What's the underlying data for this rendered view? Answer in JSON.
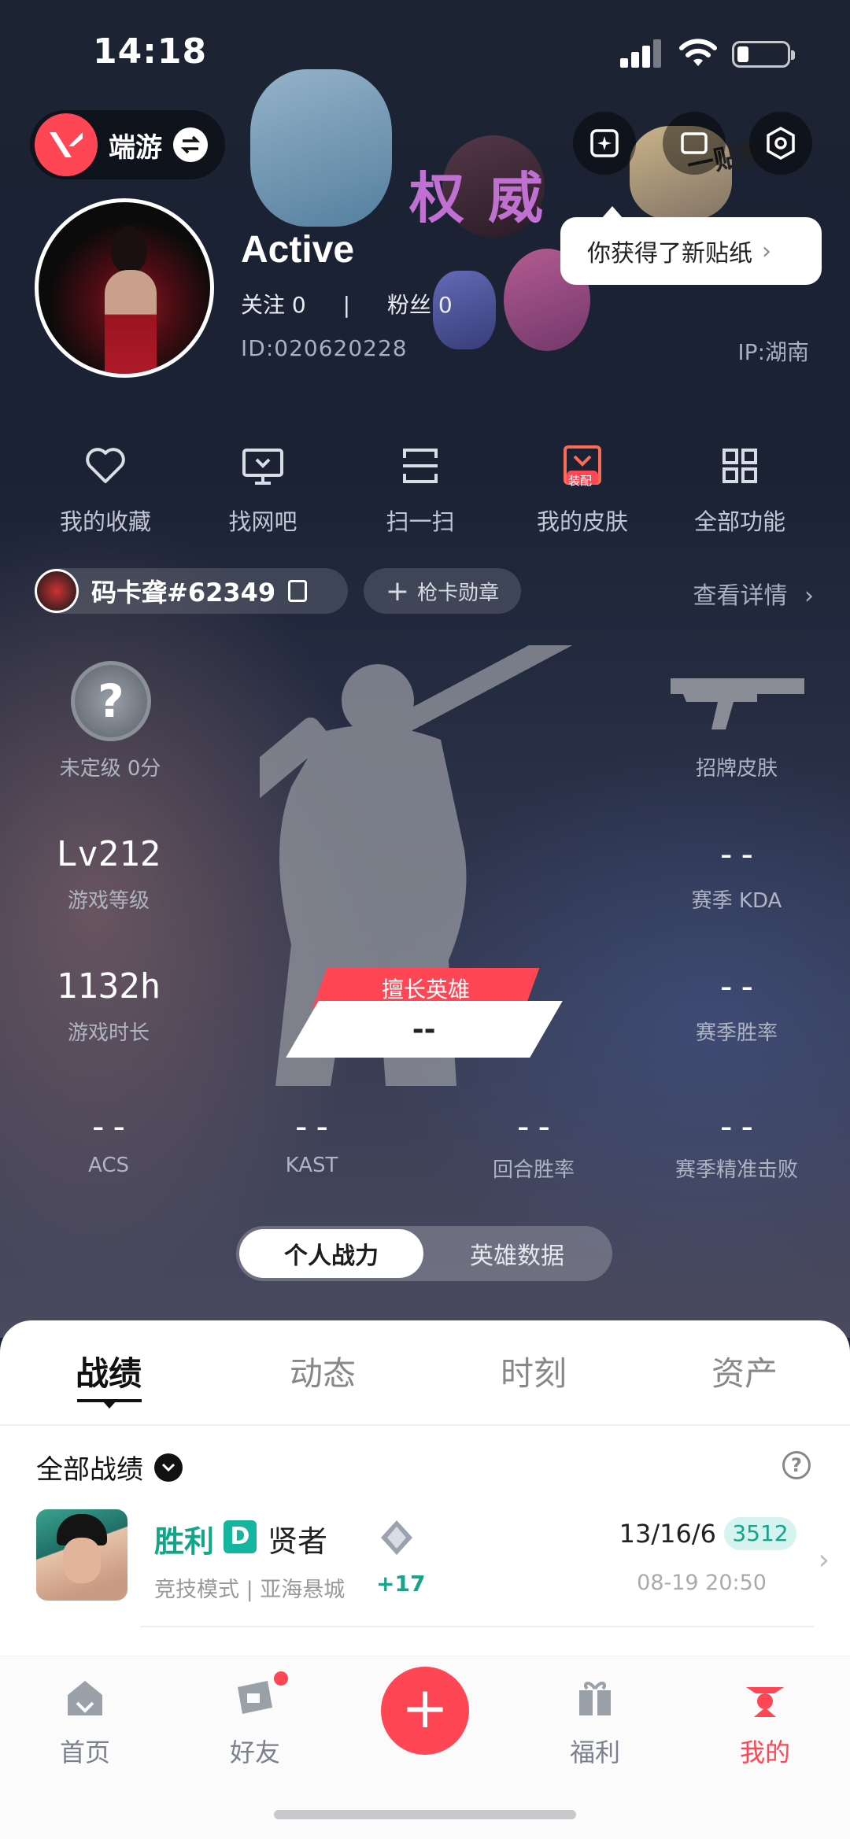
{
  "status_bar": {
    "time": "14:18"
  },
  "header": {
    "mode_label": "端游",
    "tooltip": "你获得了新贴纸",
    "sticker_text": "权威",
    "sticker_text2": "一贴秒!"
  },
  "profile": {
    "name": "Active",
    "follow": "关注 0",
    "fans": "粉丝 0",
    "separator": "|",
    "id": "ID:020620228",
    "ip": "IP:湖南"
  },
  "quick_menu": {
    "items": [
      {
        "label": "我的收藏",
        "icon": "heart-icon"
      },
      {
        "label": "找网吧",
        "icon": "monitor-icon"
      },
      {
        "label": "扫一扫",
        "icon": "scan-icon"
      },
      {
        "label": "我的皮肤",
        "icon": "skin-icon",
        "badge": "装配"
      },
      {
        "label": "全部功能",
        "icon": "grid-icon"
      }
    ]
  },
  "riot": {
    "riot_id": "码卡聋#62349",
    "medal_button": "枪卡勋章",
    "detail_link": "查看详情"
  },
  "stats": {
    "rank_label": "未定级 0分",
    "rank_icon": "?",
    "signature_skin": "招牌皮肤",
    "level_value": "Lv212",
    "level_label": "游戏等级",
    "kda_value": "--",
    "kda_label": "赛季 KDA",
    "hours_value": "1132h",
    "hours_label": "游戏时长",
    "winrate_value": "--",
    "winrate_label": "赛季胜率",
    "best_hero_tag": "擅长英雄",
    "best_hero_value": "--",
    "acs_value": "--",
    "acs_label": "ACS",
    "kast_value": "--",
    "kast_label": "KAST",
    "round_value": "--",
    "round_label": "回合胜率",
    "precision_value": "--",
    "precision_label": "赛季精准击败"
  },
  "toggle": {
    "active": "个人战力",
    "inactive": "英雄数据"
  },
  "tabs": [
    {
      "label": "战绩",
      "active": true
    },
    {
      "label": "动态"
    },
    {
      "label": "时刻"
    },
    {
      "label": "资产"
    }
  ],
  "records": {
    "filter_label": "全部战绩",
    "match": {
      "result": "胜利",
      "rank_letter": "D",
      "role": "贤者",
      "mode": "竞技模式 | 亚海悬城",
      "rr_delta": "+17",
      "kda": "13/16/6",
      "acs": "3512",
      "time": "08-19 20:50"
    }
  },
  "nav": {
    "items": [
      {
        "label": "首页",
        "icon": "home-icon"
      },
      {
        "label": "好友",
        "icon": "friends-icon"
      },
      {
        "label": "福利",
        "icon": "gift-icon"
      },
      {
        "label": "我的",
        "icon": "profile-icon",
        "active": true
      }
    ],
    "plus": "+"
  },
  "colors": {
    "accent": "#ff4655",
    "teal": "#12a58a"
  }
}
